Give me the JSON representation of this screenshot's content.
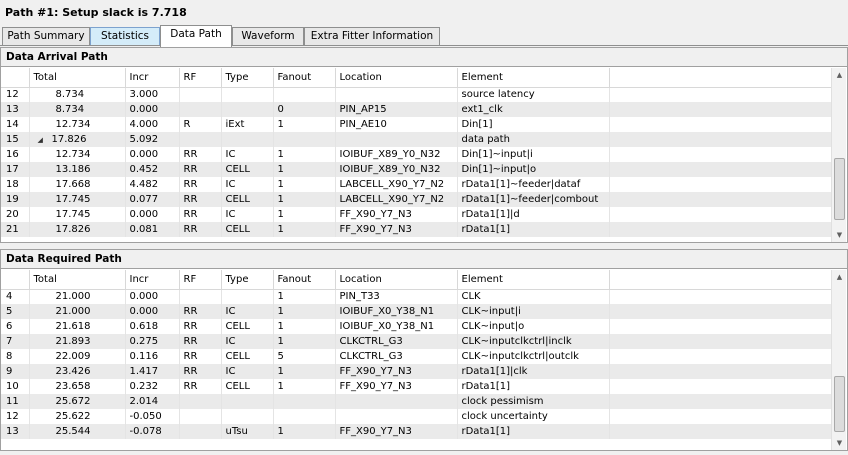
{
  "window_title": "Path #1: Setup slack is 7.718",
  "tabs": [
    {
      "label": "Path Summary"
    },
    {
      "label": "Statistics"
    },
    {
      "label": "Data Path"
    },
    {
      "label": "Waveform"
    },
    {
      "label": "Extra Fitter Information"
    }
  ],
  "active_tab": "Data Path",
  "columns": [
    "Total",
    "Incr",
    "RF",
    "Type",
    "Fanout",
    "Location",
    "Element"
  ],
  "arrival": {
    "title": "Data Arrival Path",
    "rows": [
      {
        "n": "12",
        "total": "8.734",
        "incr": "3.000",
        "rf": "",
        "type": "",
        "fanout": "",
        "location": "",
        "element": "source latency"
      },
      {
        "n": "13",
        "total": "8.734",
        "incr": "0.000",
        "rf": "",
        "type": "",
        "fanout": "0",
        "location": "PIN_AP15",
        "element": "ext1_clk"
      },
      {
        "n": "14",
        "total": "12.734",
        "incr": "4.000",
        "rf": "R",
        "type": "iExt",
        "fanout": "1",
        "location": "PIN_AE10",
        "element": "Din[1]"
      },
      {
        "n": "15",
        "total": "17.826",
        "incr": "5.092",
        "rf": "",
        "type": "",
        "fanout": "",
        "location": "",
        "element": "data path",
        "expand": "◢"
      },
      {
        "n": "16",
        "total": "12.734",
        "incr": "0.000",
        "rf": "RR",
        "type": "IC",
        "fanout": "1",
        "location": "IOIBUF_X89_Y0_N32",
        "element": "Din[1]~input|i"
      },
      {
        "n": "17",
        "total": "13.186",
        "incr": "0.452",
        "rf": "RR",
        "type": "CELL",
        "fanout": "1",
        "location": "IOIBUF_X89_Y0_N32",
        "element": "Din[1]~input|o"
      },
      {
        "n": "18",
        "total": "17.668",
        "incr": "4.482",
        "rf": "RR",
        "type": "IC",
        "fanout": "1",
        "location": "LABCELL_X90_Y7_N2",
        "element": "rData1[1]~feeder|dataf"
      },
      {
        "n": "19",
        "total": "17.745",
        "incr": "0.077",
        "rf": "RR",
        "type": "CELL",
        "fanout": "1",
        "location": "LABCELL_X90_Y7_N2",
        "element": "rData1[1]~feeder|combout"
      },
      {
        "n": "20",
        "total": "17.745",
        "incr": "0.000",
        "rf": "RR",
        "type": "IC",
        "fanout": "1",
        "location": "FF_X90_Y7_N3",
        "element": "rData1[1]|d"
      },
      {
        "n": "21",
        "total": "17.826",
        "incr": "0.081",
        "rf": "RR",
        "type": "CELL",
        "fanout": "1",
        "location": "FF_X90_Y7_N3",
        "element": "rData1[1]"
      }
    ]
  },
  "required": {
    "title": "Data Required Path",
    "rows": [
      {
        "n": "4",
        "total": "21.000",
        "incr": "0.000",
        "rf": "",
        "type": "",
        "fanout": "1",
        "location": "PIN_T33",
        "element": "CLK"
      },
      {
        "n": "5",
        "total": "21.000",
        "incr": "0.000",
        "rf": "RR",
        "type": "IC",
        "fanout": "1",
        "location": "IOIBUF_X0_Y38_N1",
        "element": "CLK~input|i"
      },
      {
        "n": "6",
        "total": "21.618",
        "incr": "0.618",
        "rf": "RR",
        "type": "CELL",
        "fanout": "1",
        "location": "IOIBUF_X0_Y38_N1",
        "element": "CLK~input|o"
      },
      {
        "n": "7",
        "total": "21.893",
        "incr": "0.275",
        "rf": "RR",
        "type": "IC",
        "fanout": "1",
        "location": "CLKCTRL_G3",
        "element": "CLK~inputclkctrl|inclk"
      },
      {
        "n": "8",
        "total": "22.009",
        "incr": "0.116",
        "rf": "RR",
        "type": "CELL",
        "fanout": "5",
        "location": "CLKCTRL_G3",
        "element": "CLK~inputclkctrl|outclk"
      },
      {
        "n": "9",
        "total": "23.426",
        "incr": "1.417",
        "rf": "RR",
        "type": "IC",
        "fanout": "1",
        "location": "FF_X90_Y7_N3",
        "element": "rData1[1]|clk"
      },
      {
        "n": "10",
        "total": "23.658",
        "incr": "0.232",
        "rf": "RR",
        "type": "CELL",
        "fanout": "1",
        "location": "FF_X90_Y7_N3",
        "element": "rData1[1]"
      },
      {
        "n": "11",
        "total": "25.672",
        "incr": "2.014",
        "rf": "",
        "type": "",
        "fanout": "",
        "location": "",
        "element": "clock pessimism"
      },
      {
        "n": "12",
        "total": "25.622",
        "incr": "-0.050",
        "rf": "",
        "type": "",
        "fanout": "",
        "location": "",
        "element": "clock uncertainty"
      },
      {
        "n": "13",
        "total": "25.544",
        "incr": "-0.078",
        "rf": "",
        "type": "uTsu",
        "fanout": "1",
        "location": "FF_X90_Y7_N3",
        "element": "rData1[1]"
      }
    ]
  }
}
